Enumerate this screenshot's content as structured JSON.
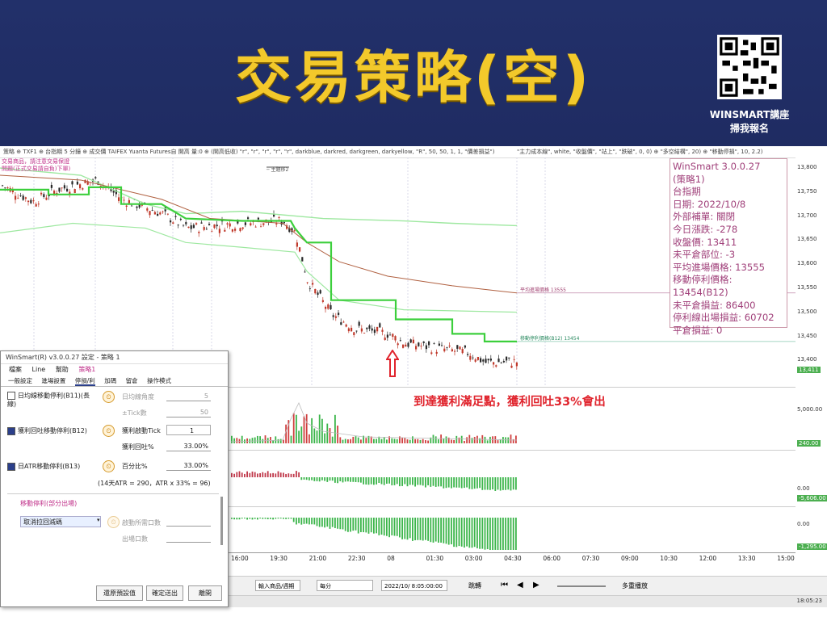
{
  "slide": {
    "title": "交易策略(空)",
    "qr_caption_1": "WINSMART講座",
    "qr_caption_2": "掃我報名"
  },
  "chart": {
    "topbar_text": "策略  ⊕ TXF1  ⊕ 台指期 5 分鐘  ⊕ 成交價  TAIFEX  Yuanta Futures自  開高  量:0 ⊕ (開高低收)  \"r\", \"r\", \"r\", \"r\", \"r\", darkblue, darkred, darkgreen, darkyellow, \"R\", 50, 50, 1, 1, \"價差損益\")",
    "topbar_right": "\"主力成本線\", white, \"收盤價\", \"站上\", \"跌破\", 0, 0) ⊕ \"多空結構\", 20) ⊕ \"移動停損\", 10, 2.2)",
    "legend_label": "─ 主題移2",
    "price_ticks": [
      "13,800",
      "13,750",
      "13,700",
      "13,650",
      "13,600",
      "13,550",
      "13,500",
      "13,450",
      "13,400"
    ],
    "last_price_tag": "13,411",
    "volume_ticks": [
      "5,000.00"
    ],
    "volume_tag": "240.00",
    "osc_ticks": [
      "0.00"
    ],
    "osc_tag": "-5,606.00",
    "osc2_ticks": [
      "0.00"
    ],
    "osc2_tag": "-1,295.00",
    "entry_line_label": "平均進場價格 13555",
    "trail_line_label": "移動停利價格(B12) 13454",
    "time_labels": [
      "16:00",
      "19:30",
      "21:00",
      "22:30",
      "08",
      "01:30",
      "03:00",
      "04:30",
      "06:00",
      "07:30",
      "09:00",
      "10:30",
      "12:00",
      "13:30",
      "15:00"
    ],
    "info_box": [
      "WinSmart 3.0.0.27",
      "(策略1)",
      "台指期",
      "日期: 2022/10/8",
      "外部補單: 關閉",
      "今日漲跌: -278",
      "收盤價: 13411",
      "未平倉部位: -3",
      "平均進場價格: 13555",
      "移動停利價格: 13454(B12)",
      "未平倉損益: 86400",
      "停利線出場損益: 60702",
      "平倉損益: 0"
    ],
    "annotation": "到達獲利滿足點，獲利回吐33%會出",
    "top_left_note_1": "交易商品，請注意交易保證",
    "top_left_note_2": "問題(正式交易請自負)下單)"
  },
  "toolbar": {
    "product_select": "輸入商品/週期",
    "interval_select": "每分",
    "datetime": "2022/10/  8:05:00:00",
    "jump_label": "跳轉",
    "multi_label": "多重播放",
    "clock": "18:05:23"
  },
  "dialog": {
    "title": "WinSmart(R) v3.0.0.27 設定 - 策略 1",
    "menu": [
      "檔案",
      "Line",
      "幫助",
      "策略1"
    ],
    "tabs": [
      "一般設定",
      "進場設置",
      "停損/利",
      "加碼",
      "留倉",
      "操作模式"
    ],
    "row1_label": "日均線移動停利(B11)(長線)",
    "row1_field1_label": "日均線角度",
    "row1_field1_value": "5",
    "row1_field2_label": "±Tick數",
    "row1_field2_value": "50",
    "row2_label": "獲利回吐移動停利(B12)",
    "row2_field1_label": "獲利啟動Tick",
    "row2_field1_value": "1",
    "row2_field2_label": "獲利回吐%",
    "row2_field2_value": "33.00%",
    "row3_label": "日ATR移動停利(B13)",
    "row3_field1_label": "百分比%",
    "row3_field1_value": "33.00%",
    "row3_note": "(14天ATR = 290，ATR x 33% = 96)",
    "section_label": "移動停利(部分出場)",
    "select_value": "取消拉回減碼",
    "opt1_label": "啟動所需口數",
    "opt2_label": "出場口數",
    "btn_reset": "還原預設值",
    "btn_apply": "確定送出",
    "btn_close": "離開"
  }
}
